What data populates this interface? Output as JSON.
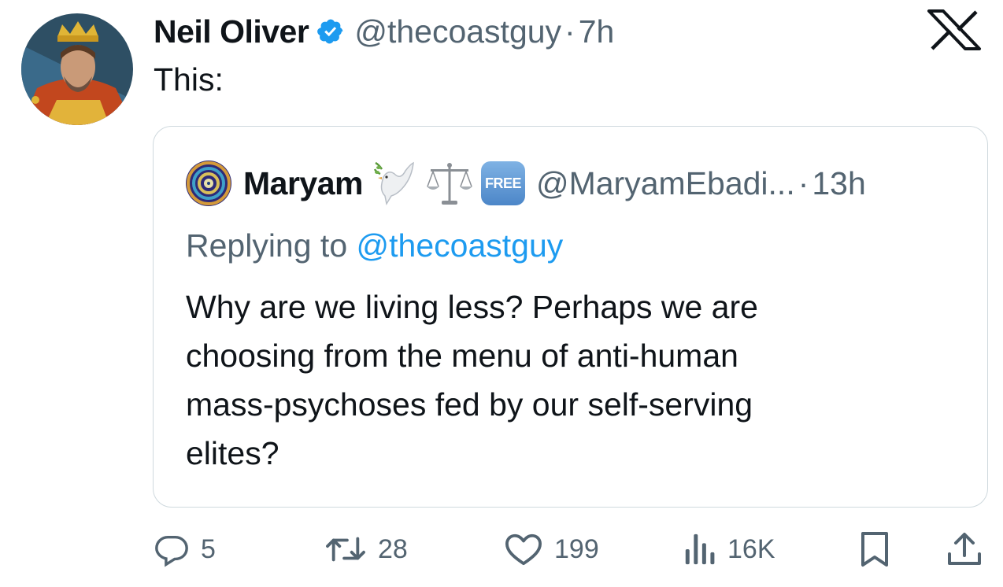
{
  "tweet": {
    "author_name": "Neil Oliver",
    "author_handle": "@thecoastguy",
    "separator": "·",
    "time": "7h",
    "text": "This:"
  },
  "quoted": {
    "author_name": "Maryam",
    "emoji_badge": "FREE",
    "author_handle": "@MaryamEbadi...",
    "separator": "·",
    "time": "13h",
    "replying_prefix": "Replying to",
    "replying_to": "@thecoastguy",
    "text": "Why are we living less?  Perhaps we are\nchoosing from the menu of anti-human\nmass-psychoses fed by our self-serving\nelites?"
  },
  "actions": {
    "replies": "5",
    "reposts": "28",
    "likes": "199",
    "views": "16K"
  },
  "icons": [
    "verified-badge-icon",
    "x-logo-icon",
    "dove-emoji",
    "scales-emoji",
    "free-emoji",
    "reply-icon",
    "repost-icon",
    "like-icon",
    "views-icon",
    "bookmark-icon",
    "share-icon"
  ],
  "colors": {
    "text": "#0f1419",
    "secondary": "#536471",
    "link": "#1d9bf0",
    "border": "#cfd9de"
  }
}
